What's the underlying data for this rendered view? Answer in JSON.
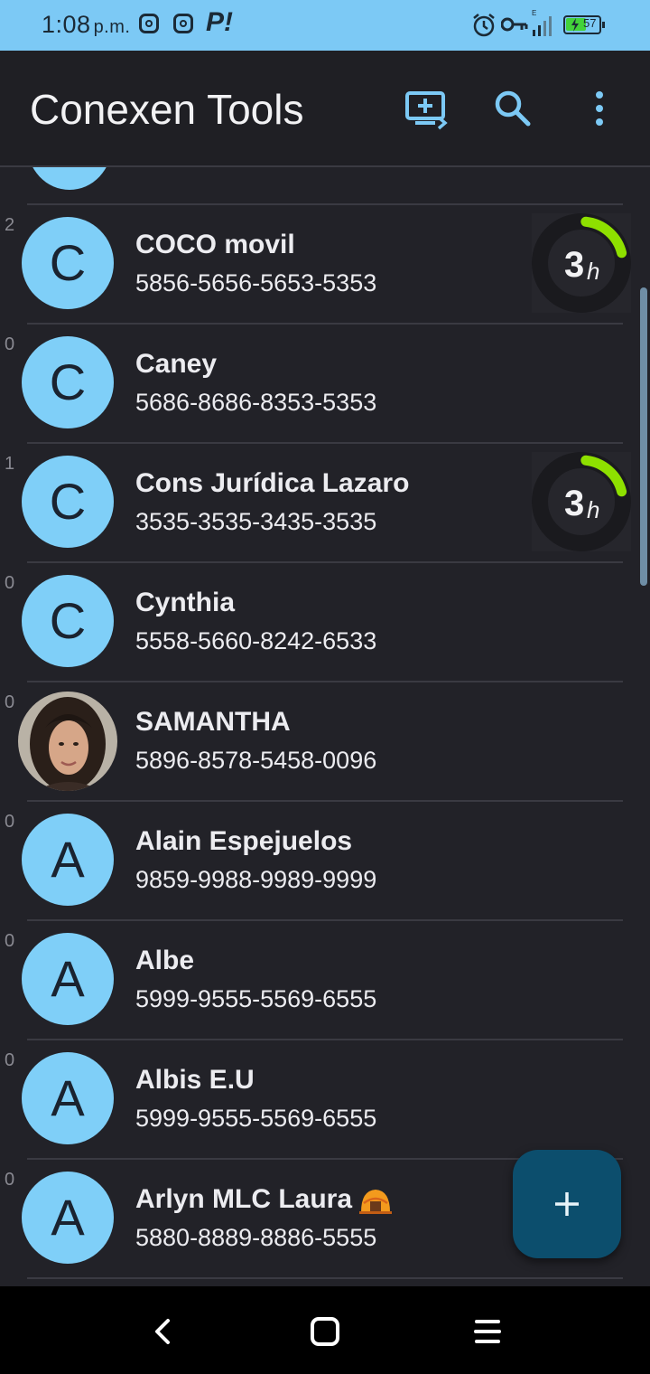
{
  "status_bar": {
    "time": "1:08",
    "ampm": "p.m.",
    "battery_level": "57",
    "icons": [
      "instagram-icon",
      "instagram-icon",
      "p-app-icon",
      "alarm-icon",
      "vpn-key-icon",
      "signal-icon",
      "battery-icon"
    ]
  },
  "app_bar": {
    "title": "Conexen Tools",
    "actions": [
      "add-to-screen-icon",
      "search-icon",
      "more-vert-icon"
    ]
  },
  "contacts": [
    {
      "count": "2",
      "initial": "C",
      "name": "COCO movil",
      "number": "5856-5656-5653-5353",
      "timer": "3",
      "timer_unit": "h"
    },
    {
      "count": "0",
      "initial": "C",
      "name": "Caney",
      "number": "5686-8686-8353-5353"
    },
    {
      "count": "1",
      "initial": "C",
      "name": "Cons Jurídica Lazaro",
      "number": "3535-3535-3435-3535",
      "timer": "3",
      "timer_unit": "h"
    },
    {
      "count": "0",
      "initial": "C",
      "name": "Cynthia",
      "number": "5558-5660-8242-6533"
    },
    {
      "count": "0",
      "initial": "",
      "name": "SAMANTHA",
      "number": "5896-8578-5458-0096",
      "photo": true
    },
    {
      "count": "0",
      "initial": "A",
      "name": "Alain Espejuelos",
      "number": "9859-9988-9989-9999"
    },
    {
      "count": "0",
      "initial": "A",
      "name": "Albe",
      "number": "5999-9555-5569-6555"
    },
    {
      "count": "0",
      "initial": "A",
      "name": "Albis E.U",
      "number": "5999-9555-5569-6555"
    },
    {
      "count": "0",
      "initial": "A",
      "name": "Arlyn MLC Laura",
      "number": "5880-8889-8886-5555",
      "emoji": "hut-icon"
    }
  ],
  "fab": {
    "icon": "add-icon"
  },
  "nav_bar": [
    "back-icon",
    "home-icon",
    "menu-icon"
  ],
  "colors": {
    "accent": "#7cc9f5",
    "avatar": "#7fcff8",
    "timer_arc": "#8ee000",
    "fab": "#0c4e6d"
  }
}
